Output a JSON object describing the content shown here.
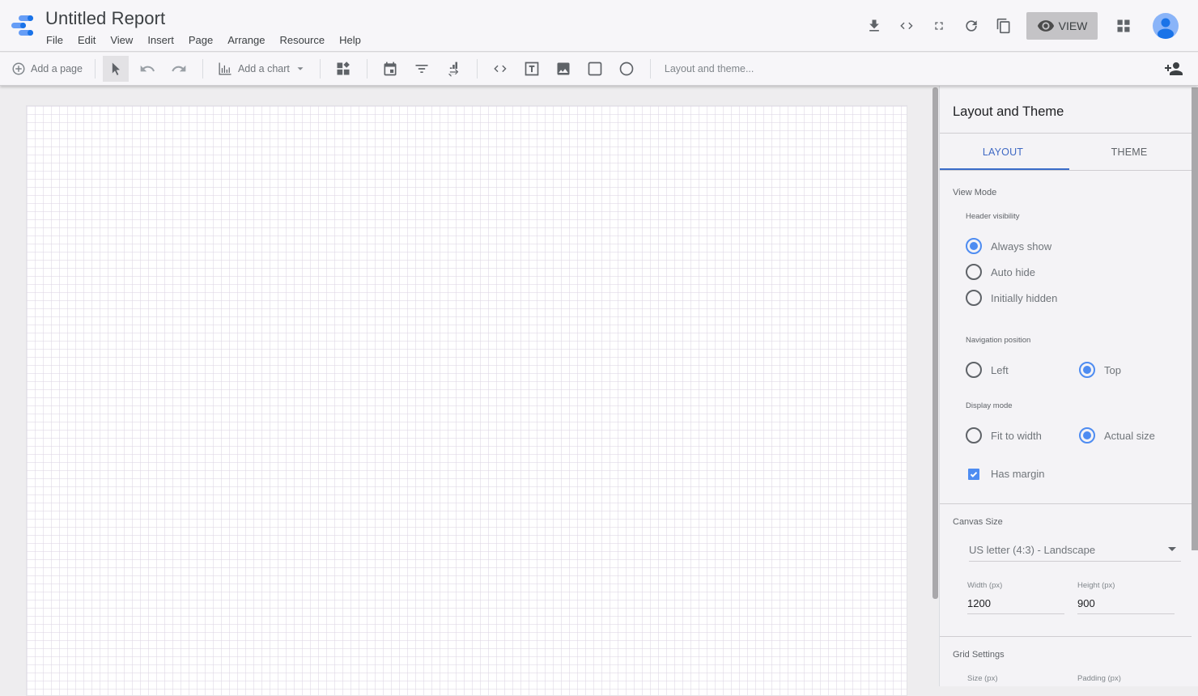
{
  "header": {
    "title": "Untitled Report",
    "menu": [
      "File",
      "Edit",
      "View",
      "Insert",
      "Page",
      "Arrange",
      "Resource",
      "Help"
    ],
    "icons": [
      "download-icon",
      "embed-icon",
      "fullscreen-icon",
      "refresh-icon",
      "copy-icon"
    ],
    "view_label": "VIEW"
  },
  "toolbar": {
    "add_page_label": "Add a page",
    "add_chart_label": "Add a chart",
    "layout_theme_label": "Layout and theme..."
  },
  "panel": {
    "title": "Layout and Theme",
    "tabs": [
      {
        "label": "LAYOUT",
        "active": true
      },
      {
        "label": "THEME",
        "active": false
      }
    ],
    "view_mode": {
      "label": "View Mode",
      "header_visibility": {
        "label": "Header visibility",
        "options": [
          "Always show",
          "Auto hide",
          "Initially hidden"
        ],
        "selected": "Always show"
      },
      "navigation_position": {
        "label": "Navigation position",
        "options": [
          "Left",
          "Top"
        ],
        "selected": "Top"
      },
      "display_mode": {
        "label": "Display mode",
        "options": [
          "Fit to width",
          "Actual size"
        ],
        "selected": "Actual size"
      },
      "has_margin": {
        "label": "Has margin",
        "checked": true
      }
    },
    "canvas_size": {
      "label": "Canvas Size",
      "preset": "US letter (4:3) - Landscape",
      "width_label": "Width (px)",
      "width_value": "1200",
      "height_label": "Height (px)",
      "height_value": "900"
    },
    "grid_settings": {
      "label": "Grid Settings",
      "size_label": "Size (px)",
      "padding_label": "Padding (px)"
    }
  },
  "colors": {
    "accent": "#4e8cf1",
    "tab_active": "#3a6cc9",
    "view_button_bg": "#c4c3c6"
  }
}
